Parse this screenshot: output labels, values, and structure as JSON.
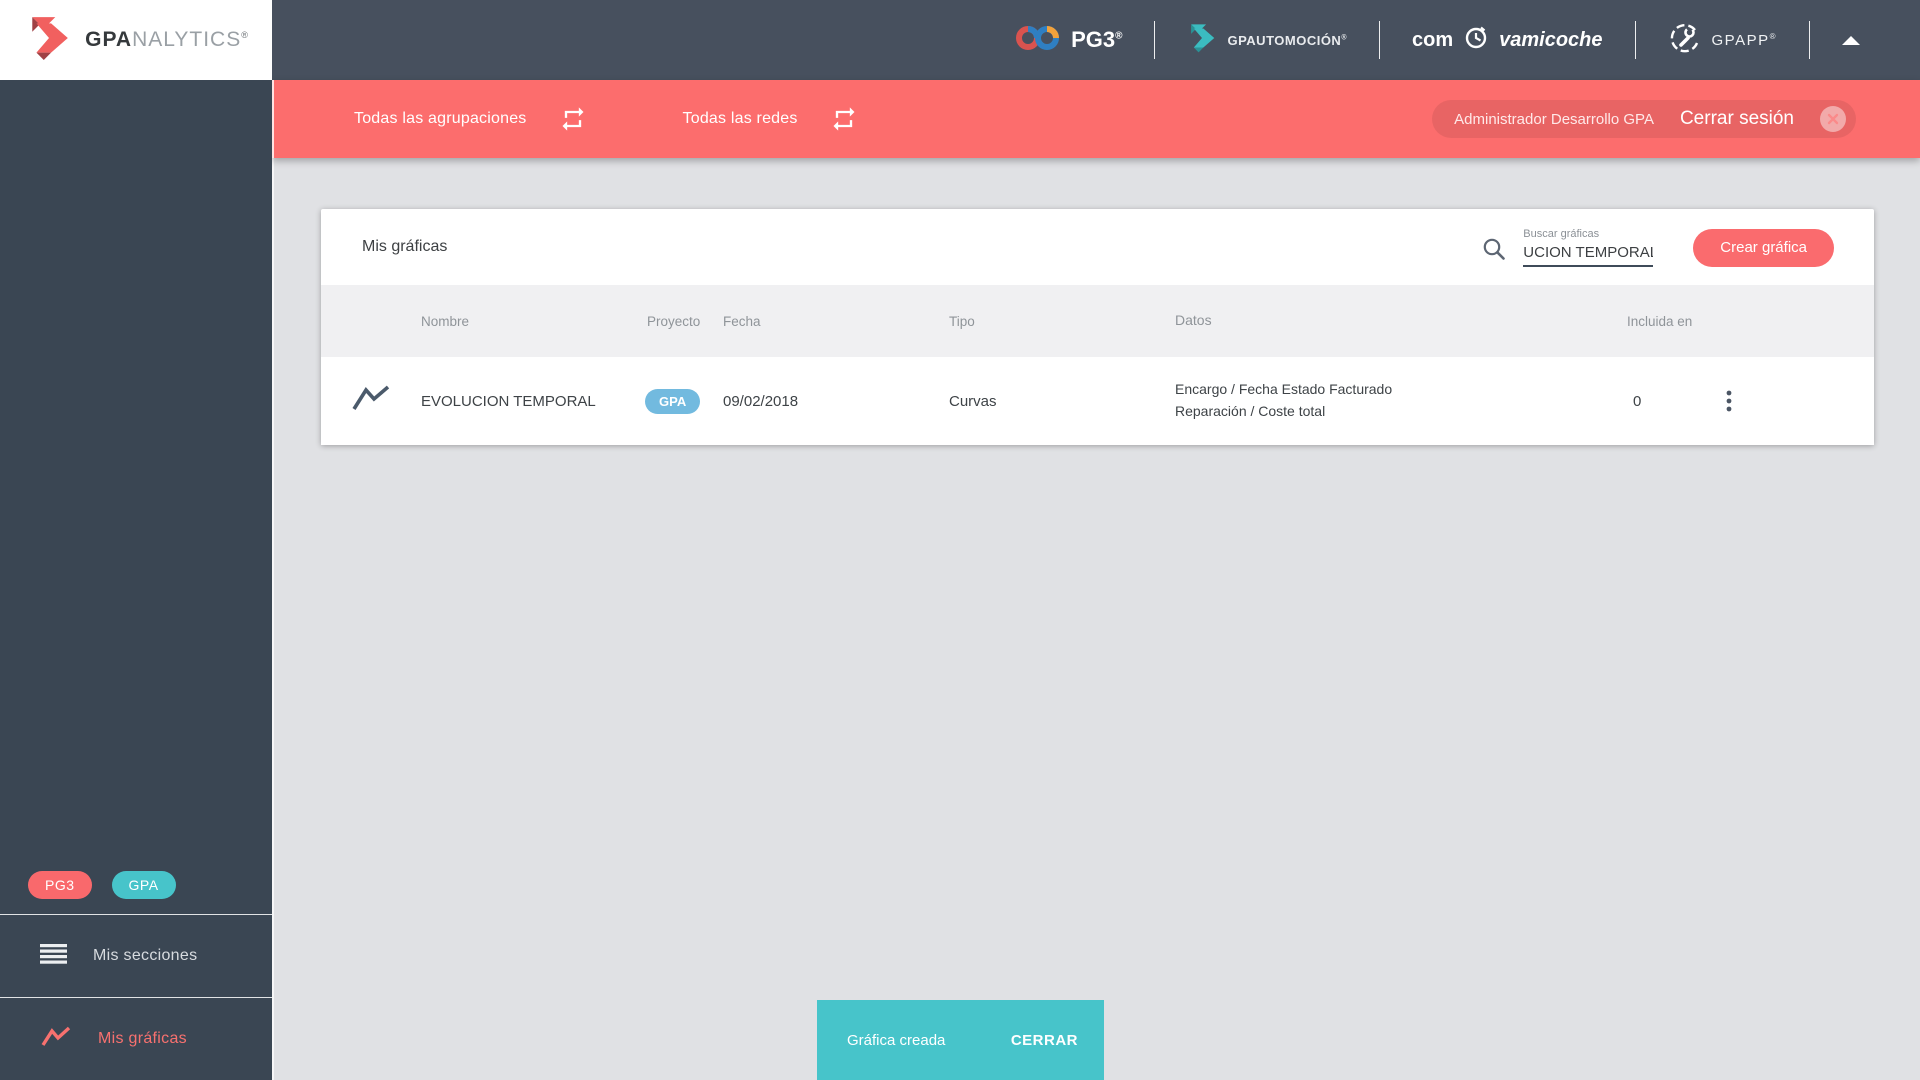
{
  "brand": {
    "bold": "GPA",
    "light": "NALYTICS",
    "reg": "®"
  },
  "header": {
    "pg3": {
      "label": "PG3",
      "reg": "®"
    },
    "automocion": {
      "label": "GPAUTOMOCIÓN",
      "reg": "®"
    },
    "comprovamicoche": {
      "pre": "com",
      "post": "vamicoche"
    },
    "gpapp": {
      "label": "GPAPP",
      "reg": "®"
    }
  },
  "filter_bar": {
    "groupings": "Todas las agrupaciones",
    "networks": "Todas las redes",
    "user": "Administrador Desarrollo GPA",
    "logout": "Cerrar sesión"
  },
  "sidebar": {
    "badge_pg3": "PG3",
    "badge_gpa": "GPA",
    "sections_item": "Mis secciones",
    "charts_item": "Mis gráficas"
  },
  "main": {
    "title": "Mis gráficas",
    "search_label": "Buscar gráficas",
    "search_value": "UCION TEMPORAL",
    "create_button": "Crear gráfica",
    "table": {
      "columns": [
        "Nombre",
        "Proyecto",
        "Fecha",
        "Tipo",
        "Datos",
        "Incluida en"
      ],
      "rows": [
        {
          "name": "EVOLUCION TEMPORAL",
          "project_badge": "GPA",
          "date": "09/02/2018",
          "type": "Curvas",
          "data_lines": [
            "Encargo / Fecha Estado Facturado",
            "Reparación / Coste total"
          ],
          "included_in": "0"
        }
      ]
    }
  },
  "toast": {
    "message": "Gráfica creada",
    "action": "CERRAR"
  },
  "colors": {
    "coral": "#fc6d6d",
    "teal": "#47c4ca",
    "header_slate": "#47505e",
    "sidebar_slate": "#3a4653",
    "project_badge_blue": "#72badf",
    "content_bg": "#e0e1e4"
  }
}
